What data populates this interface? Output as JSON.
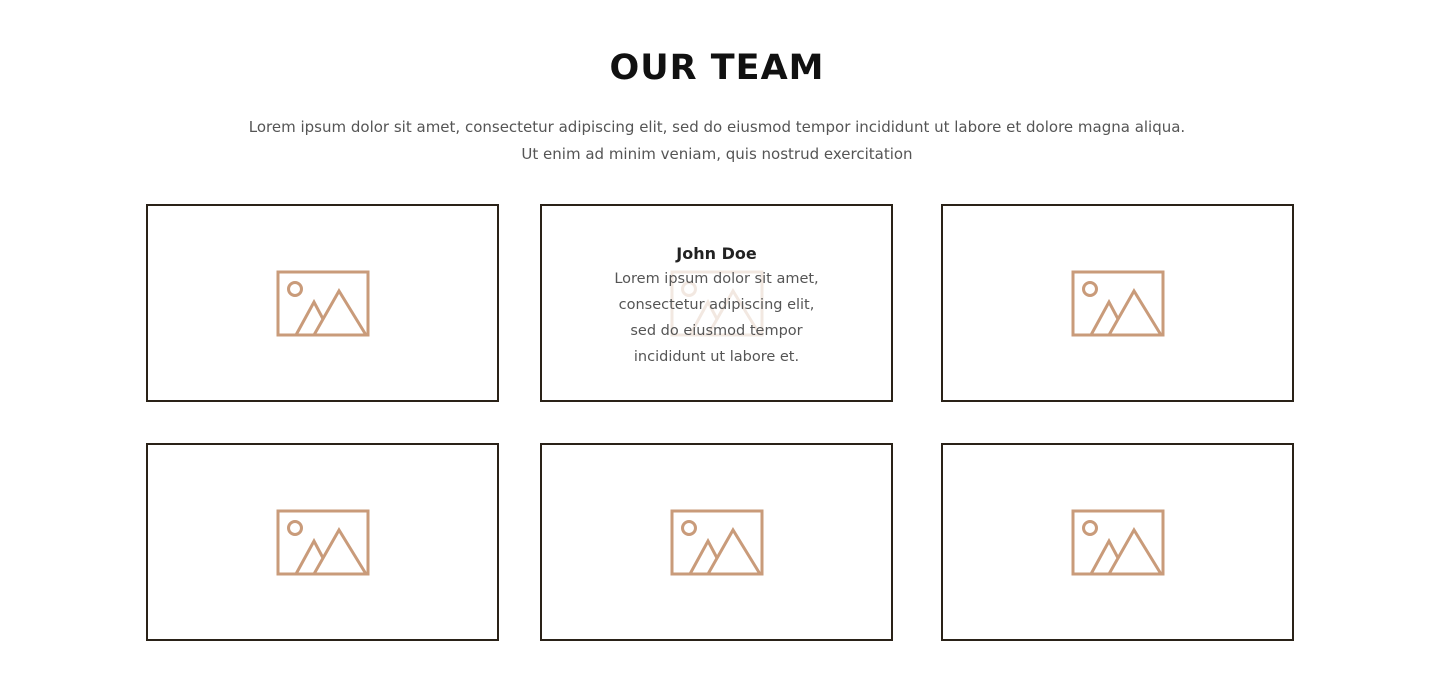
{
  "section": {
    "title": "OUR TEAM",
    "intro_line1": "Lorem ipsum dolor sit amet, consectetur adipiscing elit, sed do eiusmod tempor incididunt ut labore et dolore magna aliqua.",
    "intro_line2": "Ut enim ad minim veniam, quis nostrud exercitation"
  },
  "colors": {
    "icon_stroke": "#c99b7a",
    "card_border": "#2a2218",
    "title": "#111111",
    "body_text": "#555555"
  },
  "cards": [
    {
      "icon": "image-placeholder-icon"
    },
    {
      "icon": "image-placeholder-icon",
      "name": "John Doe",
      "bio_line1": "Lorem ipsum dolor sit amet,",
      "bio_line2": "consectetur adipiscing elit,",
      "bio_line3": "sed do eiusmod tempor",
      "bio_line4": "incididunt ut labore et."
    },
    {
      "icon": "image-placeholder-icon"
    },
    {
      "icon": "image-placeholder-icon"
    },
    {
      "icon": "image-placeholder-icon"
    },
    {
      "icon": "image-placeholder-icon"
    }
  ]
}
